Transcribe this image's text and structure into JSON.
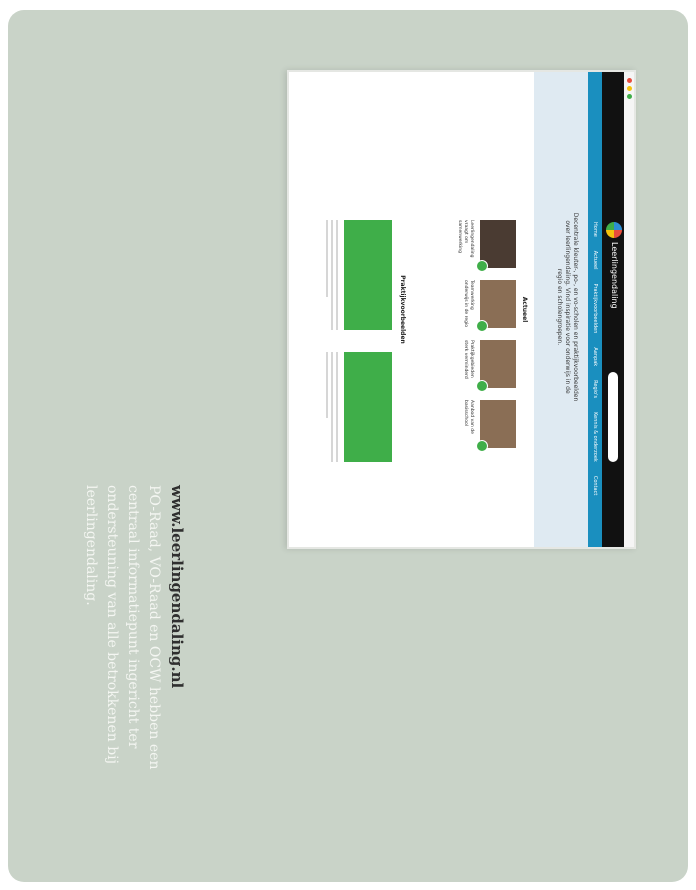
{
  "caption": {
    "url": "www.leerlingendaling.nl",
    "text": "PO-Raad, VO-Raad en OCW hebben een centraal informatiepunt ingericht ter ondersteuning van alle betrokkenen bij leerlingendaling."
  },
  "site": {
    "logo_text": "Leerlingendaling",
    "nav": [
      "Home",
      "Actueel",
      "Praktijkvoorbeelden",
      "Aanpak",
      "Regio's",
      "Kennis & onderzoek",
      "Contact"
    ],
    "tagline": "Decentrale kleuter-, po-, en vo-scholen en praktijkvoorbeelden over leerlingendaling. Vind inspiratie voor onderwijs in de regio en scholengroepen.",
    "section_actueel": "Actueel",
    "section_praktijk": "Praktijkvoorbeelden",
    "thumb_captions": [
      "Leerlingendaling vraagt om samenwerking",
      "Teamwerking onderwijs in de regio",
      "Praktijkgebieden sterk verminderd",
      "Aanbod van de basisschool"
    ]
  },
  "colors": {
    "card": "#c9d3c8",
    "nav": "#1a8fbf",
    "accent": "#3fae49"
  }
}
